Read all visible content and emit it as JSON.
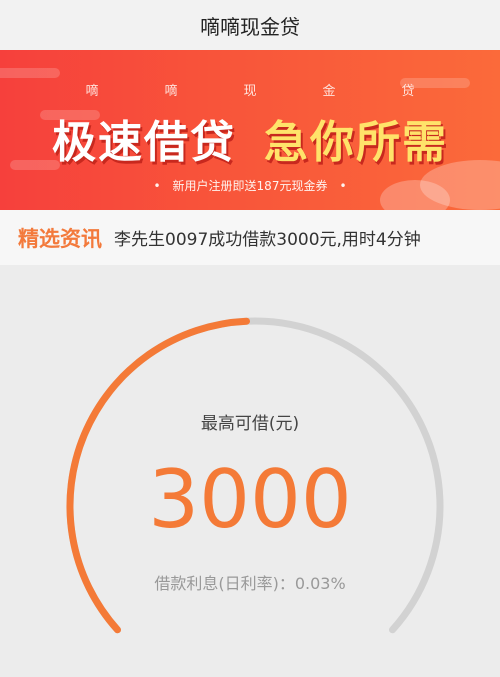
{
  "app": {
    "title": "嘀嘀现金贷"
  },
  "banner": {
    "sub_chars": [
      "嘀",
      "嘀",
      "现",
      "金",
      "贷"
    ],
    "headline_left": "极速借贷",
    "headline_right": "急你所需",
    "promo": "新用户注册即送187元现金券",
    "colors": {
      "start": "#f6403c",
      "end": "#fb6a3a"
    }
  },
  "news": {
    "label": "精选资讯",
    "text": "李先生0097成功借款3000元,用时4分钟"
  },
  "gauge": {
    "label": "最高可借(元)",
    "amount": "3000",
    "rate_text": "借款利息(日利率)：0.03%",
    "fill_fraction": 0.49,
    "accent": "#f47a37",
    "track": "#d2d2d2"
  }
}
